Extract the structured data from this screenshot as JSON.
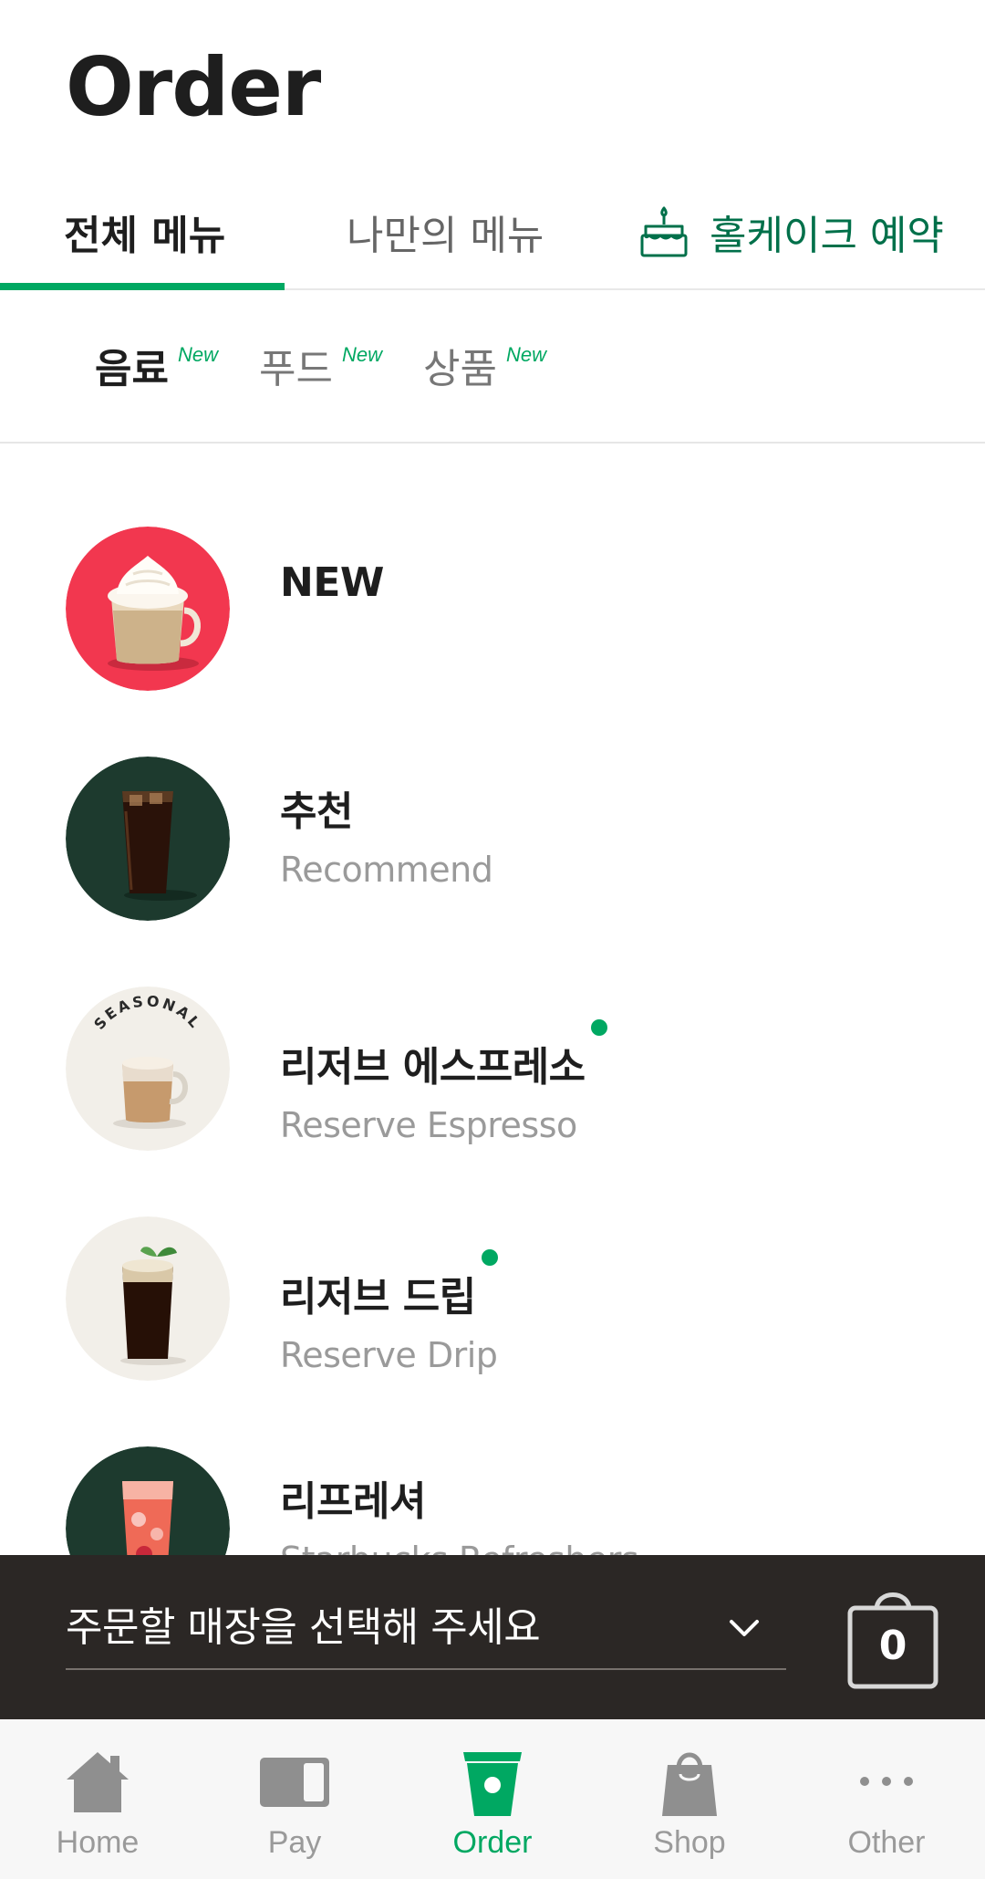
{
  "header": {
    "title": "Order"
  },
  "top_tabs": [
    {
      "label": "전체 메뉴",
      "active": true
    },
    {
      "label": "나만의 메뉴",
      "active": false
    },
    {
      "label": "홀케이크 예약",
      "icon": "cake-icon",
      "active": false
    }
  ],
  "sub_tabs": [
    {
      "label": "음료",
      "badge": "New",
      "active": true
    },
    {
      "label": "푸드",
      "badge": "New",
      "active": false
    },
    {
      "label": "상품",
      "badge": "New",
      "active": false
    }
  ],
  "menu": [
    {
      "title": "NEW",
      "subtitle": "",
      "thumb_bg": "#f2374f",
      "new_dot": false
    },
    {
      "title": "추천",
      "subtitle": "Recommend",
      "thumb_bg": "#1d3a2e",
      "new_dot": false
    },
    {
      "title": "리저브 에스프레소",
      "subtitle": "Reserve Espresso",
      "thumb_bg": "#f2efe9",
      "thumb_badge": "SEASONAL",
      "new_dot": true
    },
    {
      "title": "리저브 드립",
      "subtitle": "Reserve Drip",
      "thumb_bg": "#f2efe9",
      "new_dot": true
    },
    {
      "title": "리프레셔",
      "subtitle": "Starbucks Refreshers",
      "thumb_bg": "#1d3a2e",
      "new_dot": false
    }
  ],
  "store_bar": {
    "placeholder": "주문할 매장을 선택해 주세요",
    "cart_count": "0"
  },
  "bottom_nav": [
    {
      "label": "Home",
      "icon": "home-icon",
      "active": false
    },
    {
      "label": "Pay",
      "icon": "pay-card-icon",
      "active": false
    },
    {
      "label": "Order",
      "icon": "order-cup-icon",
      "active": true
    },
    {
      "label": "Shop",
      "icon": "shopping-bag-icon",
      "active": false
    },
    {
      "label": "Other",
      "icon": "more-dots-icon",
      "active": false
    }
  ],
  "colors": {
    "accent": "#00a862",
    "brand_dark_green": "#00704a",
    "store_bar_bg": "#2b2725"
  }
}
